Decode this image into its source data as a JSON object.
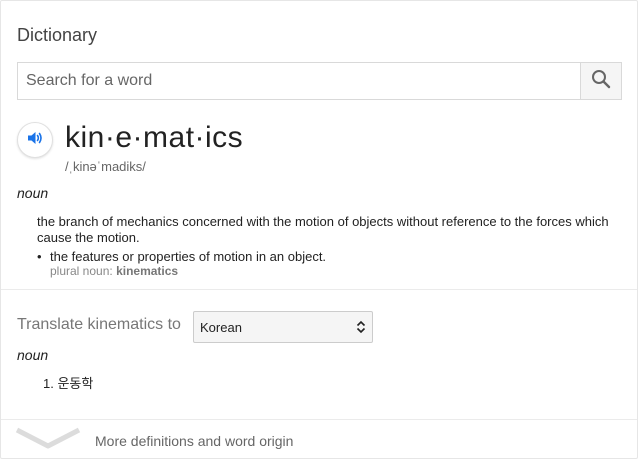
{
  "panel": {
    "title": "Dictionary"
  },
  "search": {
    "placeholder": "Search for a word",
    "value": "",
    "icon": "search-icon"
  },
  "entry": {
    "speaker_icon": "speaker-icon",
    "headword": "kin·e·mat·ics",
    "phonetic": "/ˌkinəˈmadiks/",
    "part_of_speech": "noun",
    "definition": "the branch of mechanics concerned with the motion of objects without reference to the forces which cause the motion.",
    "sub_definition": "the features or properties of motion in an object.",
    "plural_label": "plural noun:",
    "plural_value": "kinematics"
  },
  "translate": {
    "label": "Translate kinematics to",
    "language": "Korean",
    "part_of_speech": "noun",
    "items": [
      "1. 운동학"
    ]
  },
  "footer": {
    "chevron_icon": "chevron-down-icon",
    "more_label": "More definitions and word origin"
  },
  "colors": {
    "accent": "#1a73e8",
    "muted_text": "#777777",
    "divider": "#ebebeb"
  }
}
